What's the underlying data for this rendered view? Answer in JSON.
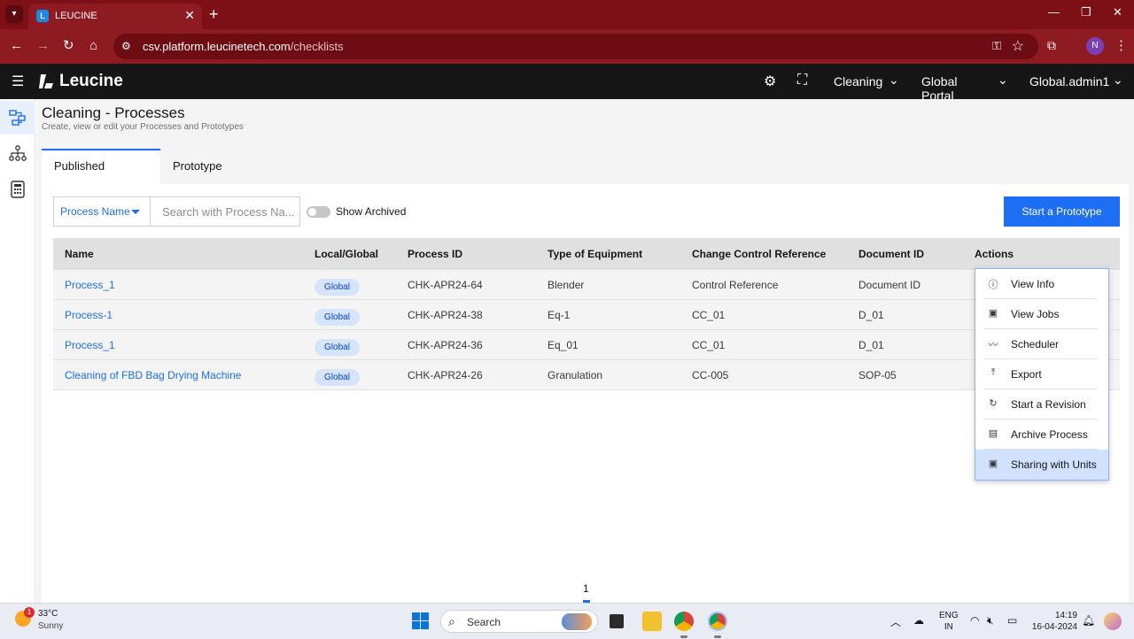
{
  "browser": {
    "tab_title": "LEUCINE",
    "tab_close": "✕",
    "new_tab": "+",
    "url_host": "csv.platform.leucinetech.com",
    "url_path": "/checklists",
    "profile_initial": "N"
  },
  "header": {
    "brand": "Leucine",
    "facility": "Cleaning",
    "portal": "Global Portal",
    "user": "Global.admin1"
  },
  "page": {
    "title": "Cleaning - Processes",
    "subtitle": "Create, view or edit your Processes and Prototypes",
    "tabs": [
      {
        "label": "Published"
      },
      {
        "label": "Prototype"
      }
    ]
  },
  "toolbar": {
    "filter_label": "Process Name",
    "search_placeholder": "Search with Process Na...",
    "show_archived_label": "Show Archived",
    "start_prototype_label": "Start a Prototype"
  },
  "table": {
    "columns": [
      "Name",
      "Local/Global",
      "Process ID",
      "Type of Equipment",
      "Change Control Reference",
      "Document ID",
      "Actions"
    ],
    "rows": [
      {
        "name": "Process_1",
        "scope": "Global",
        "process_id": "CHK-APR24-64",
        "equipment": "Blender",
        "ccr": "Control Reference",
        "doc_id": "Document ID"
      },
      {
        "name": "Process-1",
        "scope": "Global",
        "process_id": "CHK-APR24-38",
        "equipment": "Eq-1",
        "ccr": "CC_01",
        "doc_id": "D_01"
      },
      {
        "name": "Process_1",
        "scope": "Global",
        "process_id": "CHK-APR24-36",
        "equipment": "Eq_01",
        "ccr": "CC_01",
        "doc_id": "D_01"
      },
      {
        "name": "Cleaning of FBD Bag Drying Machine",
        "scope": "Global",
        "process_id": "CHK-APR24-26",
        "equipment": "Granulation",
        "ccr": "CC-005",
        "doc_id": "SOP-05"
      }
    ]
  },
  "actions_menu": {
    "items": [
      {
        "label": "View Info",
        "icon": "info-icon"
      },
      {
        "label": "View Jobs",
        "icon": "jobs-icon"
      },
      {
        "label": "Scheduler",
        "icon": "trend-icon"
      },
      {
        "label": "Export",
        "icon": "export-icon"
      },
      {
        "label": "Start a Revision",
        "icon": "refresh-icon"
      },
      {
        "label": "Archive Process",
        "icon": "archive-icon"
      },
      {
        "label": "Sharing with Units",
        "icon": "share-icon"
      }
    ],
    "highlighted_index": 6
  },
  "pagination": {
    "current_page": "1"
  },
  "taskbar": {
    "weather_temp": "33°C",
    "weather_desc": "Sunny",
    "weather_badge": "1",
    "search_label": "Search",
    "lang_line1": "ENG",
    "lang_line2": "IN",
    "time": "14:19",
    "date": "16-04-2024"
  },
  "colors": {
    "browser_frame": "#8e1a22",
    "app_header": "#161616",
    "accent": "#1d6ef2"
  }
}
